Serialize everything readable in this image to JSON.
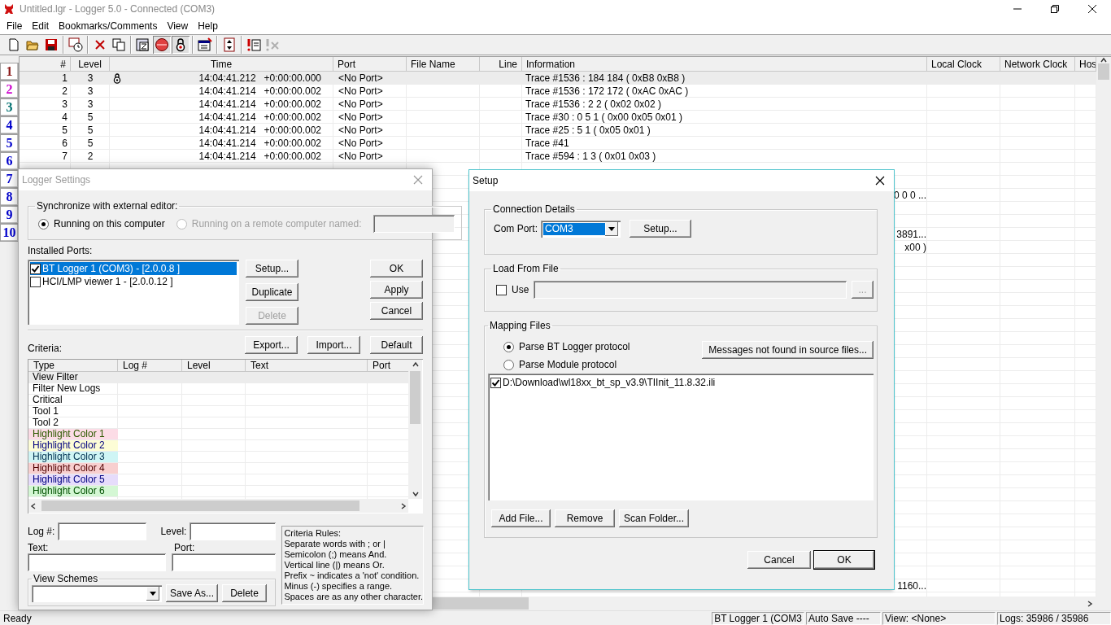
{
  "window": {
    "title": "Untitled.lgr - Logger 5.0 - Connected  (COM3)"
  },
  "menu": [
    "File",
    "Edit",
    "Bookmarks/Comments",
    "View",
    "Help"
  ],
  "toolbar": [
    {
      "kind": "new",
      "pressed": false
    },
    {
      "kind": "open",
      "pressed": false
    },
    {
      "kind": "save",
      "pressed": false
    },
    {
      "kind": "separator"
    },
    {
      "kind": "log-time",
      "pressed": false
    },
    {
      "kind": "separator"
    },
    {
      "kind": "delete",
      "pressed": false
    },
    {
      "kind": "copy",
      "pressed": false
    },
    {
      "kind": "separator"
    },
    {
      "kind": "filter",
      "pressed": false
    },
    {
      "kind": "record",
      "pressed": true
    },
    {
      "kind": "lock",
      "pressed": true
    },
    {
      "kind": "separator"
    },
    {
      "kind": "properties",
      "pressed": false
    },
    {
      "kind": "separator"
    },
    {
      "kind": "scroll",
      "pressed": false
    },
    {
      "kind": "separator"
    },
    {
      "kind": "alert",
      "pressed": false
    },
    {
      "kind": "alert-clear",
      "pressed": false,
      "disabled": true
    }
  ],
  "bookmarks": [
    {
      "label": "1",
      "color": "#8b1a1a"
    },
    {
      "label": "2",
      "color": "#cc00cc"
    },
    {
      "label": "3",
      "color": "#007070"
    },
    {
      "label": "4",
      "color": "#0000cc"
    },
    {
      "label": "5",
      "color": "#0000cc"
    },
    {
      "label": "6",
      "color": "#0000cc"
    },
    {
      "label": "7",
      "color": "#0000cc"
    },
    {
      "label": "8",
      "color": "#0000cc"
    },
    {
      "label": "9",
      "color": "#0000cc"
    },
    {
      "label": "10",
      "color": "#0000cc"
    }
  ],
  "log_table": {
    "columns": [
      "#",
      "Level",
      "Time",
      "Port",
      "File Name",
      "Line",
      "Information",
      "Local Clock",
      "Network Clock",
      "Hos"
    ],
    "rows": [
      {
        "index": "1",
        "level": "3",
        "time": "14:04:41.212",
        "delta": "+0:00:00.000",
        "port": "<No Port>",
        "information": "Trace #1536  : 184 184 ( 0xB8 0xB8 )",
        "selected": true,
        "pinned": true
      },
      {
        "index": "2",
        "level": "3",
        "time": "14:04:41.214",
        "delta": "+0:00:00.002",
        "port": "<No Port>",
        "information": "Trace #1536  : 172 172 ( 0xAC 0xAC )",
        "selected": false,
        "pinned": false
      },
      {
        "index": "3",
        "level": "3",
        "time": "14:04:41.214",
        "delta": "+0:00:00.002",
        "port": "<No Port>",
        "information": "Trace #1536  : 2 2 ( 0x02 0x02 )",
        "selected": false,
        "pinned": false
      },
      {
        "index": "4",
        "level": "5",
        "time": "14:04:41.214",
        "delta": "+0:00:00.002",
        "port": "<No Port>",
        "information": "Trace #30  : 0 5 1 ( 0x00 0x05 0x01 )",
        "selected": false,
        "pinned": false
      },
      {
        "index": "5",
        "level": "5",
        "time": "14:04:41.214",
        "delta": "+0:00:00.002",
        "port": "<No Port>",
        "information": "Trace #25  : 5 1 ( 0x05 0x01 )",
        "selected": false,
        "pinned": false
      },
      {
        "index": "6",
        "level": "5",
        "time": "14:04:41.214",
        "delta": "+0:00:00.002",
        "port": "<No Port>",
        "information": "Trace #41",
        "selected": false,
        "pinned": false
      },
      {
        "index": "7",
        "level": "2",
        "time": "14:04:41.214",
        "delta": "+0:00:00.002",
        "port": "<No Port>",
        "information": "Trace #594  : 1 3 ( 0x01 0x03 )",
        "selected": false,
        "pinned": false
      }
    ],
    "information_fragments": [
      "0 0 0 ...",
      "3891...",
      "x00 )",
      "1160..."
    ]
  },
  "logger_settings": {
    "title": "Logger Settings",
    "sync_group": {
      "label": "Synchronize with external editor:",
      "options": [
        {
          "label": "Running on this computer",
          "selected": true,
          "disabled": false
        },
        {
          "label": "Running on a remote computer named:",
          "selected": false,
          "disabled": true
        }
      ]
    },
    "ports_label": "Installed Ports:",
    "ports": [
      {
        "label": "BT Logger 1 (COM3) - [2.0.0.8 ]",
        "checked": true,
        "selected": true
      },
      {
        "label": "HCI/LMP viewer 1 - [2.0.0.12 ]",
        "checked": false,
        "selected": false
      }
    ],
    "port_buttons": [
      {
        "label": "Setup...",
        "disabled": false
      },
      {
        "label": "Duplicate",
        "disabled": false
      },
      {
        "label": "Delete",
        "disabled": true
      }
    ],
    "dialog_buttons": [
      "OK",
      "Apply",
      "Cancel"
    ],
    "criteria_label": "Criteria:",
    "criteria_buttons": [
      "Export...",
      "Import...",
      "Default"
    ],
    "criteria_columns": [
      "Type",
      "Log #",
      "Level",
      "Text",
      "Port"
    ],
    "criteria_rows": [
      {
        "type": "View Filter",
        "selected": true
      },
      {
        "type": "Filter New Logs",
        "selected": false
      },
      {
        "type": "Critical",
        "selected": false
      },
      {
        "type": "Tool 1",
        "selected": false
      },
      {
        "type": "Tool 2",
        "selected": false
      },
      {
        "type": "Highlight Color 1",
        "selected": false,
        "color": "#fcdce6",
        "font": {
          "color": "#2e5a00"
        }
      },
      {
        "type": "Highlight Color 2",
        "selected": false,
        "color": "#fdfdd6",
        "font": {
          "color": "#000080"
        }
      },
      {
        "type": "Highlight Color 3",
        "selected": false,
        "color": "#cff5f5",
        "font": {
          "color": "#003050"
        }
      },
      {
        "type": "Highlight Color 4",
        "selected": false,
        "color": "#f8cfcf",
        "font": {
          "color": "#500000"
        }
      },
      {
        "type": "Highlight Color 5",
        "selected": false,
        "color": "#e6dcfb",
        "font": {
          "color": "#000080"
        }
      },
      {
        "type": "Highlight Color 6",
        "selected": false,
        "color": "#d4f7d4",
        "font": {
          "color": "#005000"
        }
      }
    ],
    "fields": {
      "log": "Log #:",
      "level": "Level:",
      "text": "Text:",
      "port": "Port:"
    },
    "view_schemes": {
      "label": "View Schemes",
      "buttons": [
        "Save As...",
        "Delete"
      ]
    },
    "criteria_rules": [
      "Criteria Rules:",
      "Separate words with ; or |",
      "Semicolon (;) means And.",
      "Vertical line (|) means Or.",
      "Prefix ~ indicates a 'not' condition.",
      "Minus (-)  specifies a range.",
      "Spaces are as any other character."
    ]
  },
  "setup": {
    "title": "Setup",
    "connection": {
      "label": "Connection Details",
      "com_port_label": "Com Port:",
      "com_port": "COM3",
      "button": "Setup..."
    },
    "load_from_file": {
      "label": "Load From File",
      "use_label": "Use",
      "checked": false,
      "browse": "..."
    },
    "mapping": {
      "label": "Mapping Files",
      "options": [
        {
          "label": "Parse BT Logger protocol",
          "selected": true
        },
        {
          "label": "Parse Module protocol",
          "selected": false
        }
      ],
      "messages_button": "Messages not found in source files...",
      "files": [
        {
          "path": "D:\\Download\\wl18xx_bt_sp_v3.9\\TIInit_11.8.32.ili",
          "checked": true
        }
      ],
      "buttons": [
        "Add File...",
        "Remove",
        "Scan Folder..."
      ]
    },
    "buttons": [
      "Cancel",
      "OK"
    ]
  },
  "status_bar": {
    "message": "Ready",
    "panels": [
      "BT Logger 1 (COM3",
      "Auto Save ----",
      "View: <None>",
      "Logs: 35986 / 35986"
    ]
  }
}
